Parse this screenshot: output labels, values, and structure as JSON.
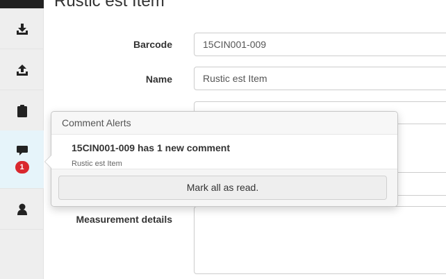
{
  "page": {
    "title": "Rustic est Item"
  },
  "sidebar": {
    "items": [
      {
        "icon": "download-icon"
      },
      {
        "icon": "upload-icon"
      },
      {
        "icon": "clipboard-icon"
      },
      {
        "icon": "comment-icon",
        "badge": "1",
        "active": true
      },
      {
        "icon": "user-icon"
      }
    ],
    "active_color": "#e6f4fa",
    "badge_color": "#d9282e"
  },
  "form": {
    "barcode": {
      "label": "Barcode",
      "value": "15CIN001-009"
    },
    "name": {
      "label": "Name",
      "value": "Rustic est Item"
    },
    "measurement_details": {
      "label": "Measurement details",
      "value": ""
    }
  },
  "comment_alerts": {
    "header": "Comment Alerts",
    "items": [
      {
        "title": "15CIN001-009 has 1 new comment",
        "subtitle": "Rustic est Item"
      }
    ],
    "mark_all_label": "Mark all as read."
  }
}
